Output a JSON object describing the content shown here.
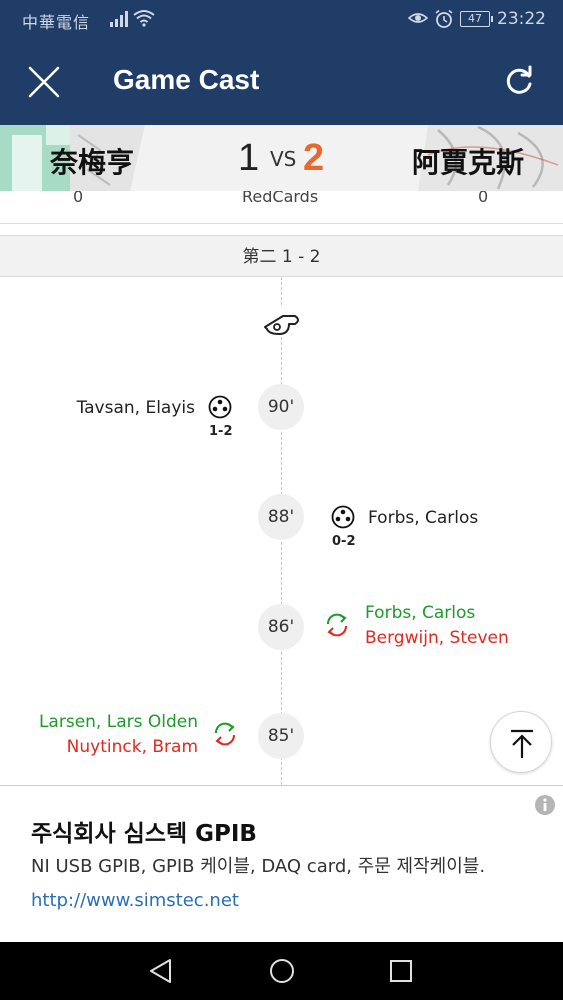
{
  "status_bar": {
    "carrier": "中華電信",
    "battery": "47",
    "time": "23:22"
  },
  "header": {
    "title": "Game Cast"
  },
  "score": {
    "home_team": "奈梅亨",
    "home_score": "1",
    "vs": "VS",
    "away_score": "2",
    "away_team": "阿賈克斯",
    "away_score_color": "#e8692d"
  },
  "stat_row": {
    "home_value": "0",
    "label": "RedCards",
    "away_value": "0"
  },
  "half": {
    "label": "第二 1 - 2"
  },
  "events": [
    {
      "minute": "90'",
      "type": "goal",
      "side": "home",
      "player": "Tavsan, Elayis",
      "score": "1-2"
    },
    {
      "minute": "88'",
      "type": "goal",
      "side": "away",
      "player": "Forbs, Carlos",
      "score": "0-2"
    },
    {
      "minute": "86'",
      "type": "substitution",
      "side": "away",
      "player_in": "Forbs, Carlos",
      "player_out": "Bergwijn, Steven"
    },
    {
      "minute": "85'",
      "type": "substitution",
      "side": "home",
      "player_in": "Larsen, Lars Olden",
      "player_out": "Nuytinck, Bram"
    }
  ],
  "colors": {
    "header_bg": "#1f3d66",
    "sub_in": "#1e9a2a",
    "sub_out": "#e02a20",
    "link": "#2a6fb5"
  },
  "ad": {
    "title": "주식회사 심스텍 GPIB",
    "description": "NI USB GPIB, GPIB 케이블, DAQ card, 주문 제작케이블.",
    "url": "http://www.simstec.net"
  },
  "icons": {
    "close": "close-icon",
    "refresh": "refresh-icon",
    "whistle": "whistle-icon",
    "goal": "soccer-ball-icon",
    "substitution": "substitution-arrows-icon",
    "scroll_top": "arrow-up-to-top-icon",
    "ad_info": "info-icon"
  }
}
